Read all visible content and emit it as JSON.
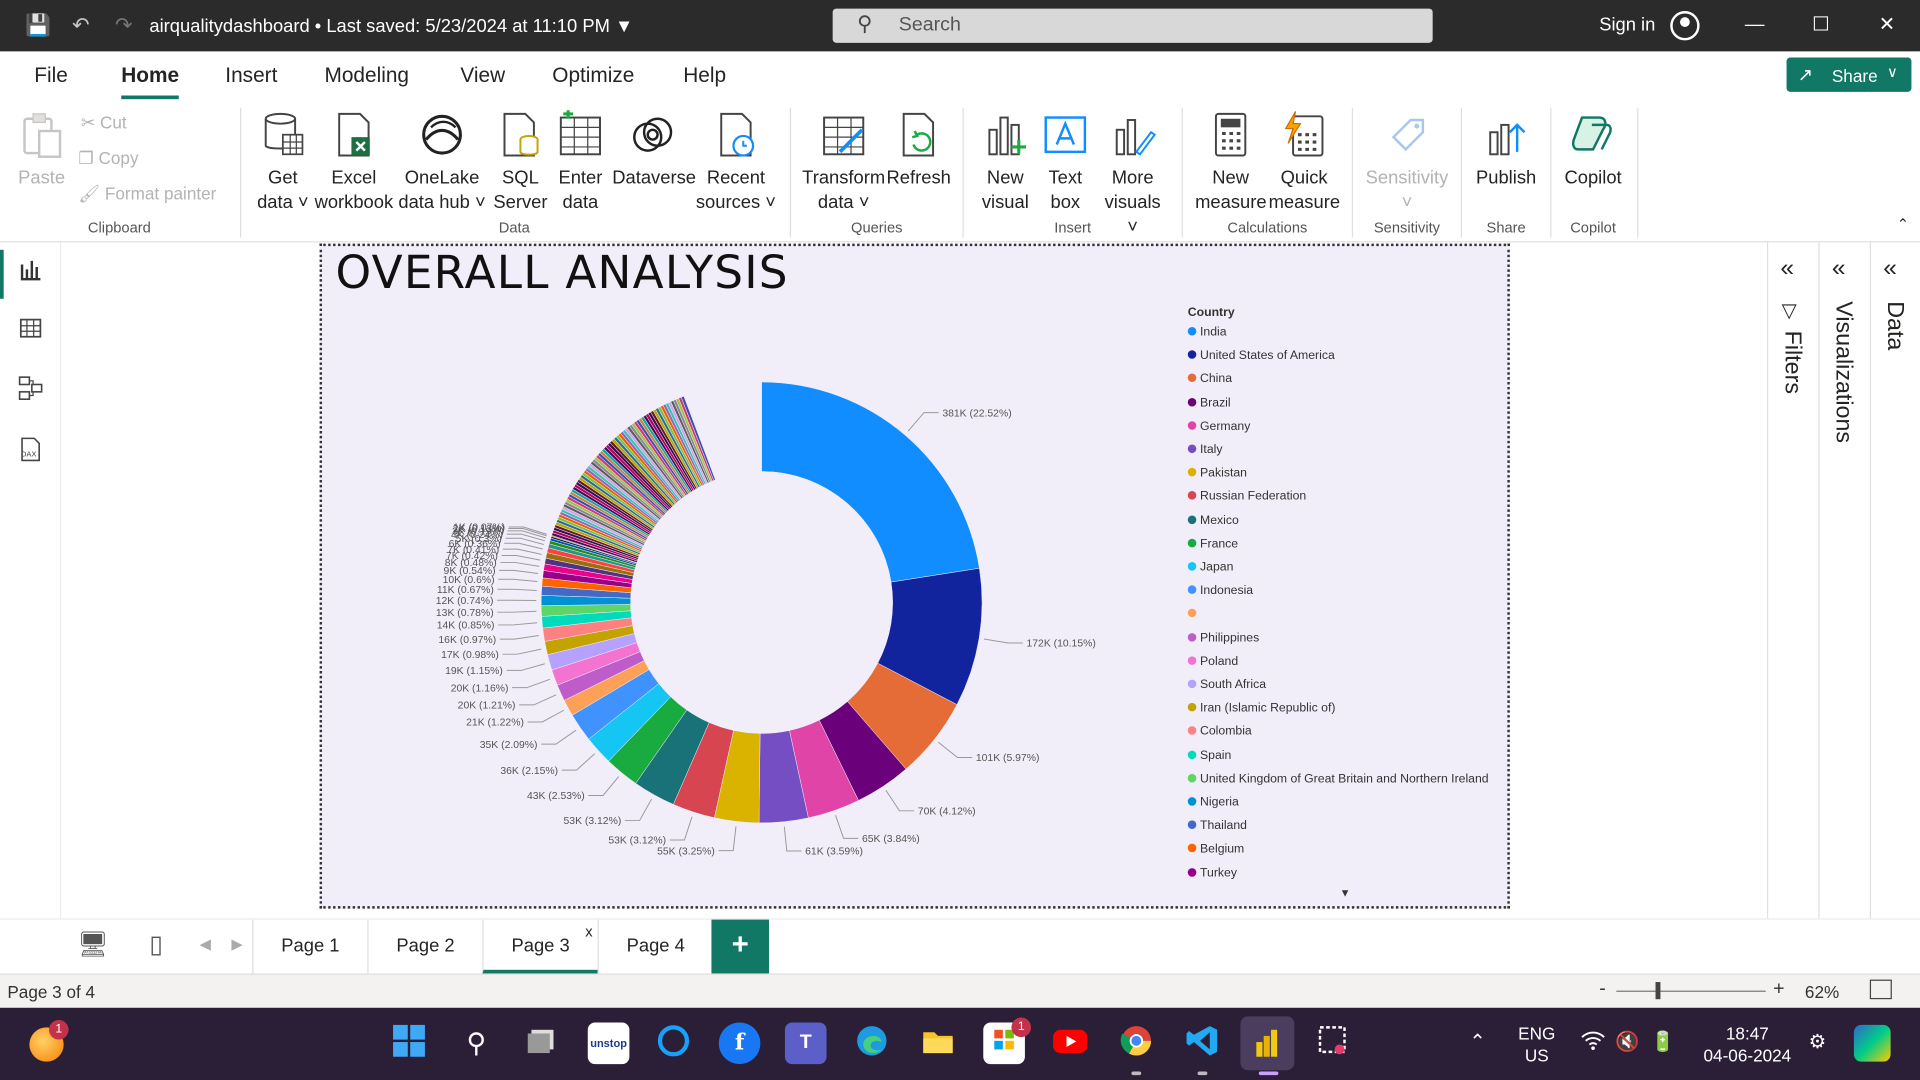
{
  "titlebar": {
    "doc_title": "airqualitydashboard • Last saved: 5/23/2024 at 11:10 PM",
    "search_placeholder": "Search",
    "sign_in": "Sign in"
  },
  "menu": {
    "tabs": [
      "File",
      "Home",
      "Insert",
      "Modeling",
      "View",
      "Optimize",
      "Help"
    ],
    "active": "Home",
    "share_label": "Share"
  },
  "ribbon": {
    "clipboard": {
      "paste": "Paste",
      "cut": "Cut",
      "copy": "Copy",
      "format_painter": "Format painter",
      "group": "Clipboard"
    },
    "data": {
      "get_data": [
        "Get",
        "data ˅"
      ],
      "excel": [
        "Excel",
        "workbook"
      ],
      "onelake": [
        "OneLake",
        "data hub ˅"
      ],
      "sql": [
        "SQL",
        "Server"
      ],
      "enter_data": [
        "Enter",
        "data"
      ],
      "dataverse": [
        "Dataverse",
        ""
      ],
      "recent_sources": [
        "Recent",
        "sources ˅"
      ],
      "group": "Data"
    },
    "queries": {
      "transform": [
        "Transform",
        "data ˅"
      ],
      "refresh": [
        "Refresh",
        ""
      ],
      "group": "Queries"
    },
    "insert": {
      "new_visual": [
        "New",
        "visual"
      ],
      "text_box": [
        "Text",
        "box"
      ],
      "more_visuals": [
        "More",
        "visuals ˅"
      ],
      "group": "Insert"
    },
    "calculations": {
      "new_measure": [
        "New",
        "measure"
      ],
      "quick_measure": [
        "Quick",
        "measure"
      ],
      "group": "Calculations"
    },
    "sensitivity": {
      "label": [
        "Sensitivity",
        "˅"
      ],
      "group": "Sensitivity"
    },
    "share": {
      "publish": [
        "Publish",
        ""
      ],
      "group": "Share"
    },
    "copilot": {
      "label": [
        "Copilot",
        ""
      ],
      "group": "Copilot"
    }
  },
  "report": {
    "title": "OVERALL ANALYSIS",
    "legend_title": "Country"
  },
  "chart_data": {
    "type": "pie",
    "donut": true,
    "legend_title": "Country",
    "legend_placement": "right",
    "slices": [
      {
        "label": "India",
        "value": 381000,
        "percent": 22.52,
        "data_label": "381K (22.52%)",
        "color": "#118DFF"
      },
      {
        "label": "United States of America",
        "value": 172000,
        "percent": 10.15,
        "data_label": "172K (10.15%)",
        "color": "#12239E"
      },
      {
        "label": "China",
        "value": 101000,
        "percent": 5.97,
        "data_label": "101K (5.97%)",
        "color": "#E66C37"
      },
      {
        "label": "Brazil",
        "value": 70000,
        "percent": 4.12,
        "data_label": "70K (4.12%)",
        "color": "#6B007B"
      },
      {
        "label": "Germany",
        "value": 65000,
        "percent": 3.84,
        "data_label": "65K (3.84%)",
        "color": "#E044A7"
      },
      {
        "label": "Italy",
        "value": 61000,
        "percent": 3.59,
        "data_label": "61K (3.59%)",
        "color": "#744EC2"
      },
      {
        "label": "Pakistan",
        "value": 55000,
        "percent": 3.25,
        "data_label": "55K (3.25%)",
        "color": "#D9B300"
      },
      {
        "label": "Russian Federation",
        "value": 53000,
        "percent": 3.12,
        "data_label": "53K (3.12%)",
        "color": "#D64550"
      },
      {
        "label": "Mexico",
        "value": 53000,
        "percent": 3.12,
        "data_label": "53K (3.12%)",
        "color": "#197278"
      },
      {
        "label": "France",
        "value": 43000,
        "percent": 2.53,
        "data_label": "43K (2.53%)",
        "color": "#1AAB40"
      },
      {
        "label": "Japan",
        "value": 36000,
        "percent": 2.15,
        "data_label": "36K (2.15%)",
        "color": "#15C6F4"
      },
      {
        "label": "Indonesia",
        "value": 35000,
        "percent": 2.09,
        "data_label": "35K (2.09%)",
        "color": "#4092FF"
      },
      {
        "label": "",
        "value": 21000,
        "percent": 1.22,
        "data_label": "21K (1.22%)",
        "color": "#FFA058"
      },
      {
        "label": "Philippines",
        "value": 20000,
        "percent": 1.21,
        "data_label": "20K (1.21%)",
        "color": "#BE5DC9"
      },
      {
        "label": "Poland",
        "value": 20000,
        "percent": 1.16,
        "data_label": "20K (1.16%)",
        "color": "#F472D0"
      },
      {
        "label": "South Africa",
        "value": 19000,
        "percent": 1.15,
        "data_label": "19K (1.15%)",
        "color": "#B5A1FF"
      },
      {
        "label": "Iran (Islamic Republic of)",
        "value": 17000,
        "percent": 0.98,
        "data_label": "17K (0.98%)",
        "color": "#C4A200"
      },
      {
        "label": "Colombia",
        "value": 16000,
        "percent": 0.97,
        "data_label": "16K (0.97%)",
        "color": "#FF8080"
      },
      {
        "label": "Spain",
        "value": 14000,
        "percent": 0.85,
        "data_label": "14K (0.85%)",
        "color": "#00DBBC"
      },
      {
        "label": "United Kingdom of Great Britain and Northern Ireland",
        "value": 13000,
        "percent": 0.78,
        "data_label": "13K (0.78%)",
        "color": "#5BD667"
      },
      {
        "label": "Nigeria",
        "value": 12000,
        "percent": 0.74,
        "data_label": "12K (0.74%)",
        "color": "#0091D5"
      },
      {
        "label": "Thailand",
        "value": 11000,
        "percent": 0.67,
        "data_label": "11K (0.67%)",
        "color": "#4668C5"
      },
      {
        "label": "Belgium",
        "value": 10000,
        "percent": 0.6,
        "data_label": "10K (0.6%)",
        "color": "#FF6300"
      },
      {
        "label": "Turkey",
        "value": 9000,
        "percent": 0.54,
        "data_label": "9K (0.54%)",
        "color": "#99008A"
      },
      {
        "label": "",
        "value": 8000,
        "percent": 0.48,
        "data_label": "8K (0.48%)",
        "color": "#EC008C"
      },
      {
        "label": "",
        "value": 7000,
        "percent": 0.42,
        "data_label": "7K (0.42%)",
        "color": "#533285"
      },
      {
        "label": "",
        "value": 7000,
        "percent": 0.41,
        "data_label": "7K (0.41%)",
        "color": "#99700A"
      },
      {
        "label": "",
        "value": 6000,
        "percent": 0.36,
        "data_label": "6K (0.36%)",
        "color": "#FF4141"
      },
      {
        "label": "",
        "value": 5000,
        "percent": 0.3,
        "data_label": "5K (0.3%)",
        "color": "#1F9A85"
      },
      {
        "label": "",
        "value": 4000,
        "percent": 0.24,
        "data_label": "4K (0.24%)",
        "color": "#25891C"
      },
      {
        "label": "",
        "value": 3000,
        "percent": 0.19,
        "data_label": "3K (0.19%)",
        "color": "#0057A2"
      },
      {
        "label": "",
        "value": 2000,
        "percent": 0.13,
        "data_label": "2K (0.13%)",
        "color": "#002050"
      },
      {
        "label": "",
        "value": 1000,
        "percent": 0.07,
        "data_label": "1K (0.07%)",
        "color": "#C94F0F"
      }
    ],
    "other_remainder_percent": 14.34,
    "other_palette": [
      "#450F54",
      "#B60064",
      "#34124F",
      "#6A1C21",
      "#B3AA00",
      "#2F6B99",
      "#7FC241",
      "#F25C05",
      "#8C6BB1",
      "#3AC3B4",
      "#D4A2E8",
      "#5E5E5E",
      "#8A8A8A",
      "#A3C14A",
      "#CF3A72",
      "#3E4EB8",
      "#C6873B",
      "#1CA0A7"
    ]
  },
  "legend": {
    "entries": [
      {
        "label": "India",
        "color": "#118DFF"
      },
      {
        "label": "United States of America",
        "color": "#12239E"
      },
      {
        "label": "China",
        "color": "#E66C37"
      },
      {
        "label": "Brazil",
        "color": "#6B007B"
      },
      {
        "label": "Germany",
        "color": "#E044A7"
      },
      {
        "label": "Italy",
        "color": "#744EC2"
      },
      {
        "label": "Pakistan",
        "color": "#D9B300"
      },
      {
        "label": "Russian Federation",
        "color": "#D64550"
      },
      {
        "label": "Mexico",
        "color": "#197278"
      },
      {
        "label": "France",
        "color": "#1AAB40"
      },
      {
        "label": "Japan",
        "color": "#15C6F4"
      },
      {
        "label": "Indonesia",
        "color": "#4092FF"
      },
      {
        "label": "",
        "color": "#FFA058"
      },
      {
        "label": "Philippines",
        "color": "#BE5DC9"
      },
      {
        "label": "Poland",
        "color": "#F472D0"
      },
      {
        "label": "South Africa",
        "color": "#B5A1FF"
      },
      {
        "label": "Iran (Islamic Republic of)",
        "color": "#C4A200"
      },
      {
        "label": "Colombia",
        "color": "#FF8080"
      },
      {
        "label": "Spain",
        "color": "#00DBBC"
      },
      {
        "label": "United Kingdom of Great Britain and Northern Ireland",
        "color": "#5BD667"
      },
      {
        "label": "Nigeria",
        "color": "#0091D5"
      },
      {
        "label": "Thailand",
        "color": "#4668C5"
      },
      {
        "label": "Belgium",
        "color": "#FF6300"
      },
      {
        "label": "Turkey",
        "color": "#99008A"
      }
    ],
    "more_indicator": "▼"
  },
  "panes": {
    "filters": "Filters",
    "visualizations": "Visualizations",
    "data": "Data"
  },
  "pages": {
    "tabs": [
      "Page 1",
      "Page 2",
      "Page 3",
      "Page 4"
    ],
    "active": "Page 3",
    "close": "x",
    "add": "+"
  },
  "status": {
    "page_of": "Page 3 of 4",
    "zoom": "62%"
  },
  "taskbar": {
    "apps": [
      {
        "name": "windows-start",
        "badge": ""
      },
      {
        "name": "search",
        "badge": ""
      },
      {
        "name": "task-view",
        "badge": ""
      },
      {
        "name": "unstop",
        "badge": ""
      },
      {
        "name": "cortana",
        "badge": ""
      },
      {
        "name": "facebook",
        "badge": ""
      },
      {
        "name": "teams",
        "badge": ""
      },
      {
        "name": "edge",
        "badge": ""
      },
      {
        "name": "file-explorer",
        "badge": ""
      },
      {
        "name": "microsoft-store",
        "badge": "1"
      },
      {
        "name": "youtube",
        "badge": ""
      },
      {
        "name": "chrome",
        "badge": ""
      },
      {
        "name": "vscode",
        "badge": ""
      },
      {
        "name": "power-bi",
        "badge": ""
      },
      {
        "name": "snipping-tool",
        "badge": ""
      }
    ],
    "weather_badge": "1",
    "lang_line1": "ENG",
    "lang_line2": "US",
    "time": "18:47",
    "date": "04-06-2024"
  }
}
